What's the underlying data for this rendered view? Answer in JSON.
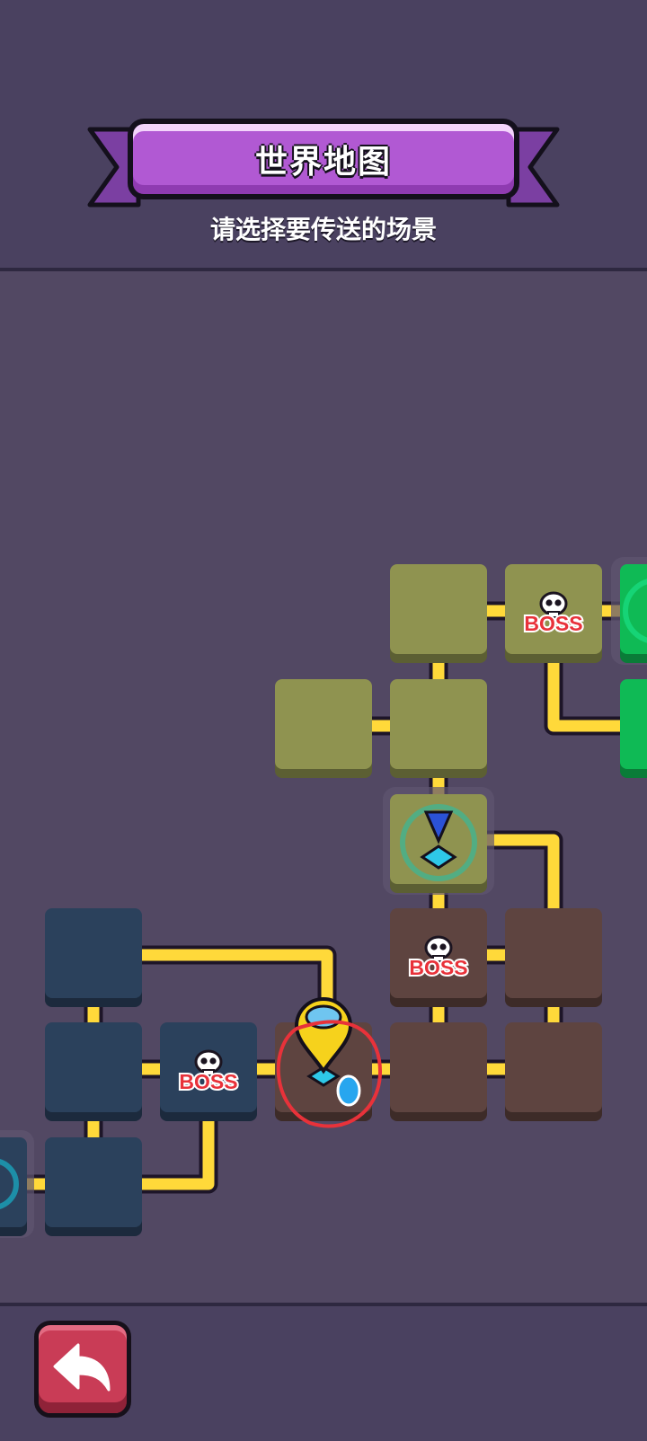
{
  "header": {
    "title": "世界地图",
    "subtitle": "请选择要传送的场景"
  },
  "map": {
    "boss_label": "BOSS",
    "colors": {
      "olive": "#8f9350",
      "brown": "#5e4440",
      "navy": "#2b415c",
      "green": "#0fba55",
      "path": "#ffd93a",
      "highlight": "#e8323a"
    },
    "tiles": [
      {
        "id": "tile-olive-r1c4",
        "zone": "olive",
        "boss": false
      },
      {
        "id": "tile-olive-r1c5-boss",
        "zone": "olive",
        "boss": true
      },
      {
        "id": "tile-green-r1c6",
        "zone": "green",
        "boss": false
      },
      {
        "id": "tile-olive-r2c3",
        "zone": "olive",
        "boss": false
      },
      {
        "id": "tile-olive-r2c4",
        "zone": "olive",
        "boss": false
      },
      {
        "id": "tile-green-r2c6",
        "zone": "green",
        "boss": false
      },
      {
        "id": "tile-olive-r3c4-teleport",
        "zone": "olive",
        "boss": false,
        "teleporter": true
      },
      {
        "id": "tile-navy-r4c1",
        "zone": "navy",
        "boss": false
      },
      {
        "id": "tile-brown-r4c4-boss",
        "zone": "brown",
        "boss": true
      },
      {
        "id": "tile-brown-r4c5",
        "zone": "brown",
        "boss": false
      },
      {
        "id": "tile-navy-r5c1",
        "zone": "navy",
        "boss": false
      },
      {
        "id": "tile-navy-r5c2-boss",
        "zone": "navy",
        "boss": true
      },
      {
        "id": "tile-brown-r5c3-current",
        "zone": "brown",
        "boss": false,
        "current": true
      },
      {
        "id": "tile-brown-r5c4",
        "zone": "brown",
        "boss": false
      },
      {
        "id": "tile-brown-r5c5",
        "zone": "brown",
        "boss": false
      },
      {
        "id": "tile-navy-r6c0",
        "zone": "navy",
        "boss": false
      },
      {
        "id": "tile-navy-r6c1",
        "zone": "navy",
        "boss": false
      }
    ]
  },
  "footer": {
    "back_icon": "back-arrow-icon"
  }
}
